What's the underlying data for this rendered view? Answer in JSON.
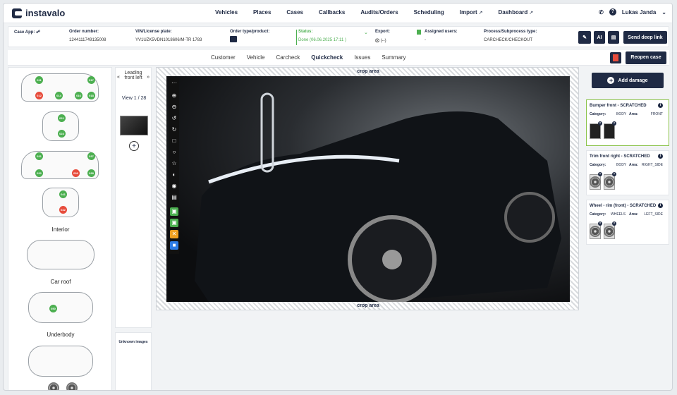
{
  "nav": {
    "brand": "instavalo",
    "menu": [
      "Vehicles",
      "Places",
      "Cases",
      "Callbacks",
      "Audits/Orders",
      "Scheduling",
      "Import",
      "Dashboard"
    ],
    "user": "Lukas Janda"
  },
  "info": {
    "case_app": "Case App:",
    "order_number_label": "Order number:",
    "order_number": "1244111749135008",
    "vin_label": "VIN/License plate:",
    "vin": "YV1UZK5VDN1018606/M-TR 1783",
    "order_type_label": "Order type/product:",
    "status_label": "Status:",
    "status": "Done (06.06.2025 17:11 )",
    "export_label": "Export:",
    "export": "(--)",
    "assigned_label": "Assigned users:",
    "assigned": "-",
    "process_label": "Process/Subprocess type:",
    "process": "CARCHECK/CHECKOUT",
    "ai": "AI",
    "send_deep_link": "Send deep link"
  },
  "tabs": [
    "Customer",
    "Vehicle",
    "Carcheck",
    "Quickcheck",
    "Issues",
    "Summary"
  ],
  "active_tab": "Quickcheck",
  "reopen_case": "Reopen case",
  "left": {
    "sections": [
      "Interior",
      "Car roof",
      "Underbody"
    ],
    "side_dots": [
      [
        "011",
        "g"
      ],
      [
        "012",
        "r"
      ],
      [
        "014",
        "g"
      ],
      [
        "016",
        "g"
      ],
      [
        "017",
        "g"
      ],
      [
        "018",
        "g"
      ]
    ],
    "front_dots": [
      [
        "021",
        "g"
      ],
      [
        "024",
        "g"
      ]
    ],
    "other_side_dots": [
      [
        "031",
        "g"
      ],
      [
        "032",
        "g"
      ],
      [
        "036",
        "r"
      ],
      [
        "037",
        "g"
      ],
      [
        "038",
        "g"
      ]
    ],
    "rear_dots": [
      [
        "041",
        "g"
      ],
      [
        "042",
        "r"
      ]
    ],
    "roof_dot": "050"
  },
  "thumbs": {
    "view_name": "Leading front left",
    "view_label": "View",
    "view_count": "1 / 28",
    "unknown": "Unknown images"
  },
  "viewer": {
    "crop_label": "crop area"
  },
  "add_damage": "Add damage",
  "damages": [
    {
      "title": "Bumper front - SCRATCHED",
      "category_label": "Category:",
      "category": "BODY",
      "area_label": "Area:",
      "area": "FRONT"
    },
    {
      "title": "Trim front right - SCRATCHED",
      "category_label": "Category:",
      "category": "BODY",
      "area_label": "Area:",
      "area": "RIGHT_SIDE"
    },
    {
      "title": "Wheel - rim (front) - SCRATCHED",
      "category_label": "Category:",
      "category": "WHEELS",
      "area_label": "Area:",
      "area": "LEFT_SIDE"
    }
  ]
}
